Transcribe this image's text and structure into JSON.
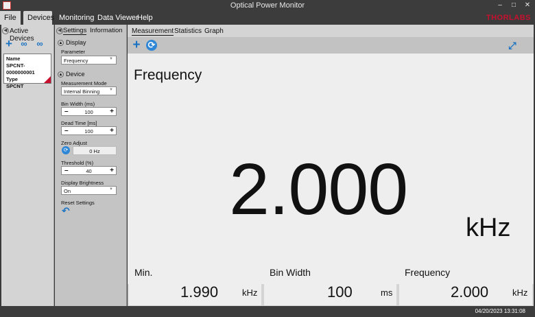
{
  "window": {
    "title": "Optical Power Monitor"
  },
  "menu": {
    "file": "File",
    "devices": "Devices",
    "monitoring": "Monitoring",
    "data_viewer": "Data Viewer",
    "help": "Help",
    "brand": "THORLABS"
  },
  "left_panel": {
    "header": "Active Devices",
    "device": {
      "name_label": "Name",
      "name": "SPCNT-0000000001",
      "type_label": "Type",
      "type": "SPCNT"
    }
  },
  "settings_panel": {
    "tabs": [
      "Settings",
      "Information"
    ],
    "display_section": "Display",
    "parameter_label": "Parameter",
    "parameter_value": "Frequency",
    "device_section": "Device",
    "measurement_mode_label": "Measurement Mode",
    "measurement_mode_value": "Internal Binning",
    "bin_width_label": "Bin Width (ms)",
    "bin_width_value": "100",
    "dead_time_label": "Dead Time [ms]",
    "dead_time_value": "100",
    "zero_adjust_label": "Zero Adjust",
    "zero_adjust_value": "0 Hz",
    "threshold_label": "Threshold (%)",
    "threshold_value": "40",
    "brightness_label": "Display Brightness",
    "brightness_value": "On",
    "reset_label": "Reset Settings"
  },
  "main": {
    "tabs": [
      "Measurement",
      "Statistics",
      "Graph"
    ],
    "parameter_title": "Frequency",
    "value": "2.000",
    "unit": "kHz",
    "stats": [
      {
        "title": "Min.",
        "value": "1.990",
        "unit": "kHz"
      },
      {
        "title": "Bin Width",
        "value": "100",
        "unit": "ms"
      },
      {
        "title": "Frequency",
        "value": "2.000",
        "unit": "kHz"
      }
    ]
  },
  "status": {
    "datetime": "04/20/2023 13:31:08"
  },
  "colors": {
    "accent": "#1a73c2",
    "brand": "#c8102e",
    "chrome": "#3c3c3c"
  }
}
